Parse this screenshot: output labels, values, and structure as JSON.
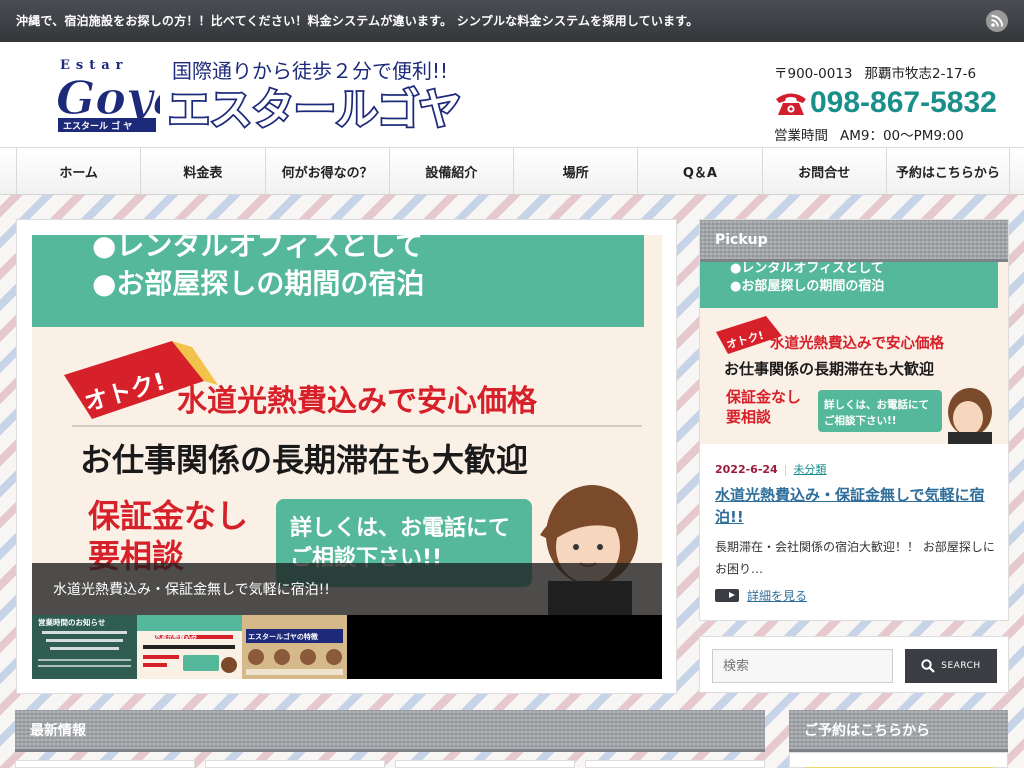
{
  "topbar": {
    "tagline": "沖縄で、宿泊施設をお探しの方！！比べてください！料金システムが違います。 シンプルな料金システムを採用しています。",
    "rss_icon": "rss-icon"
  },
  "header": {
    "logo": {
      "estar": "Estar",
      "goya": "Goya",
      "kana": "エスタール ゴ ヤ"
    },
    "slogan": "国際通りから徒歩２分で便利!!",
    "brand": "エスタールゴヤ",
    "postal": "〒900-0013",
    "address": "那覇市牧志2-17-6",
    "phone": "098-867-5832",
    "hours_label": "営業時間",
    "hours": "AM9：00〜PM9:00"
  },
  "nav": {
    "items": [
      {
        "label": "ホーム"
      },
      {
        "label": "料金表"
      },
      {
        "label": "何がお得なの？"
      },
      {
        "label": "設備紹介"
      },
      {
        "label": "場所"
      },
      {
        "label": "Q＆A"
      },
      {
        "label": "お問合せ"
      },
      {
        "label": "予約はこちらから"
      }
    ]
  },
  "slider": {
    "flyer": {
      "line1": "●レンタルオフィスとして",
      "line2": "●お部屋探しの期間の宿泊",
      "otoku": "オトク!",
      "headline": "水道光熱費込みで安心価格",
      "sub": "お仕事関係の長期滞在も大歓迎",
      "deposit1": "保証金なし",
      "deposit2": "要相談",
      "bubble1": "詳しくは、お電話にて",
      "bubble2": "ご相談下さい!!"
    },
    "caption": "水道光熱費込み・保証金無しで気軽に宿泊!!",
    "thumbs": [
      {
        "name": "thumb-hours",
        "title": "営業時間のお知らせ"
      },
      {
        "name": "thumb-flyer",
        "title": "水道光熱費込み"
      },
      {
        "name": "thumb-features",
        "title": "エスタールゴヤの特徴"
      }
    ]
  },
  "pickup": {
    "title": "Pickup",
    "date": "2022-6-24",
    "category": "未分類",
    "post_title": "水道光熱費込み・保証金無しで気軽に宿泊!!",
    "excerpt": "長期滞在・会社関係の宿泊大歓迎！！ お部屋探しにお困り…",
    "more": "詳細を見る"
  },
  "search": {
    "placeholder": "検索",
    "button": "SEARCH"
  },
  "widgets": {
    "news_title": "最新情報",
    "reserve_title": "ご予約はこちらから"
  },
  "colors": {
    "accent_teal": "#1a8f8a",
    "flyer_green": "#55b89a",
    "headline_red": "#d6202a",
    "logo_navy": "#1d2a7a",
    "phone_red": "#d21f2d"
  }
}
